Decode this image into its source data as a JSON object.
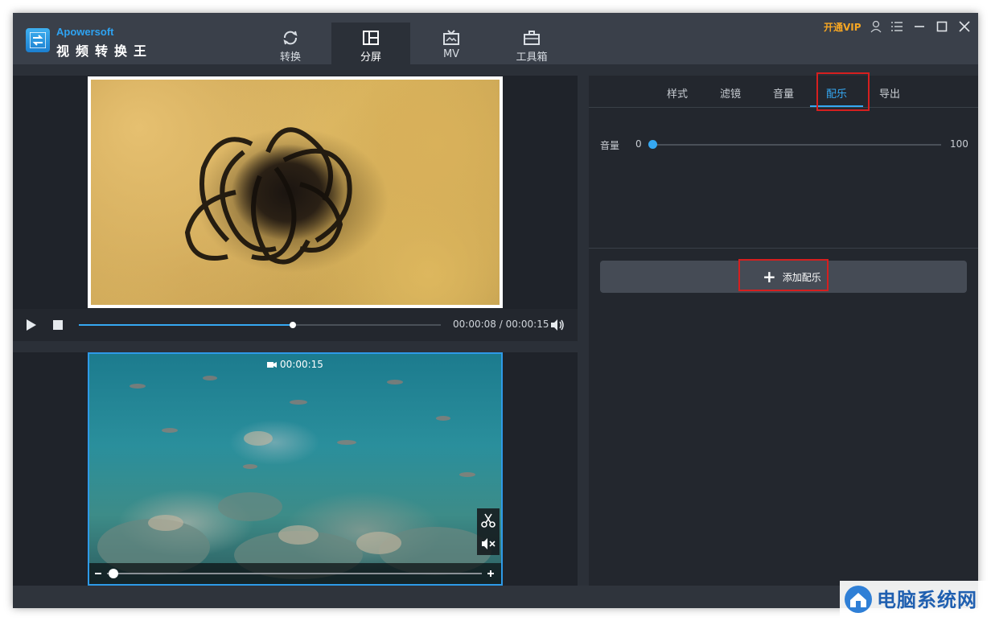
{
  "app": {
    "brand_en": "Apowersoft",
    "brand_cn": "视频转换王",
    "vip_label": "开通VIP"
  },
  "nav": {
    "tabs": [
      {
        "label": "转换",
        "icon": "refresh-icon"
      },
      {
        "label": "分屏",
        "icon": "split-screen-icon",
        "active": true
      },
      {
        "label": "MV",
        "icon": "tv-icon"
      },
      {
        "label": "工具箱",
        "icon": "toolbox-icon"
      }
    ]
  },
  "player": {
    "time": "00:00:08 / 00:00:15",
    "progress": 0.59
  },
  "clip": {
    "duration": "00:00:15"
  },
  "right": {
    "tabs": [
      {
        "label": "样式"
      },
      {
        "label": "滤镜"
      },
      {
        "label": "音量"
      },
      {
        "label": "配乐",
        "active": true
      },
      {
        "label": "导出"
      }
    ],
    "volume": {
      "label": "音量",
      "min": "0",
      "max": "100",
      "value": 0
    },
    "add_music": "添加配乐"
  },
  "watermark": {
    "text": "电脑系统网"
  },
  "colors": {
    "accent": "#35a8f2",
    "highlight": "#d61f1f",
    "vip": "#f5a623"
  }
}
